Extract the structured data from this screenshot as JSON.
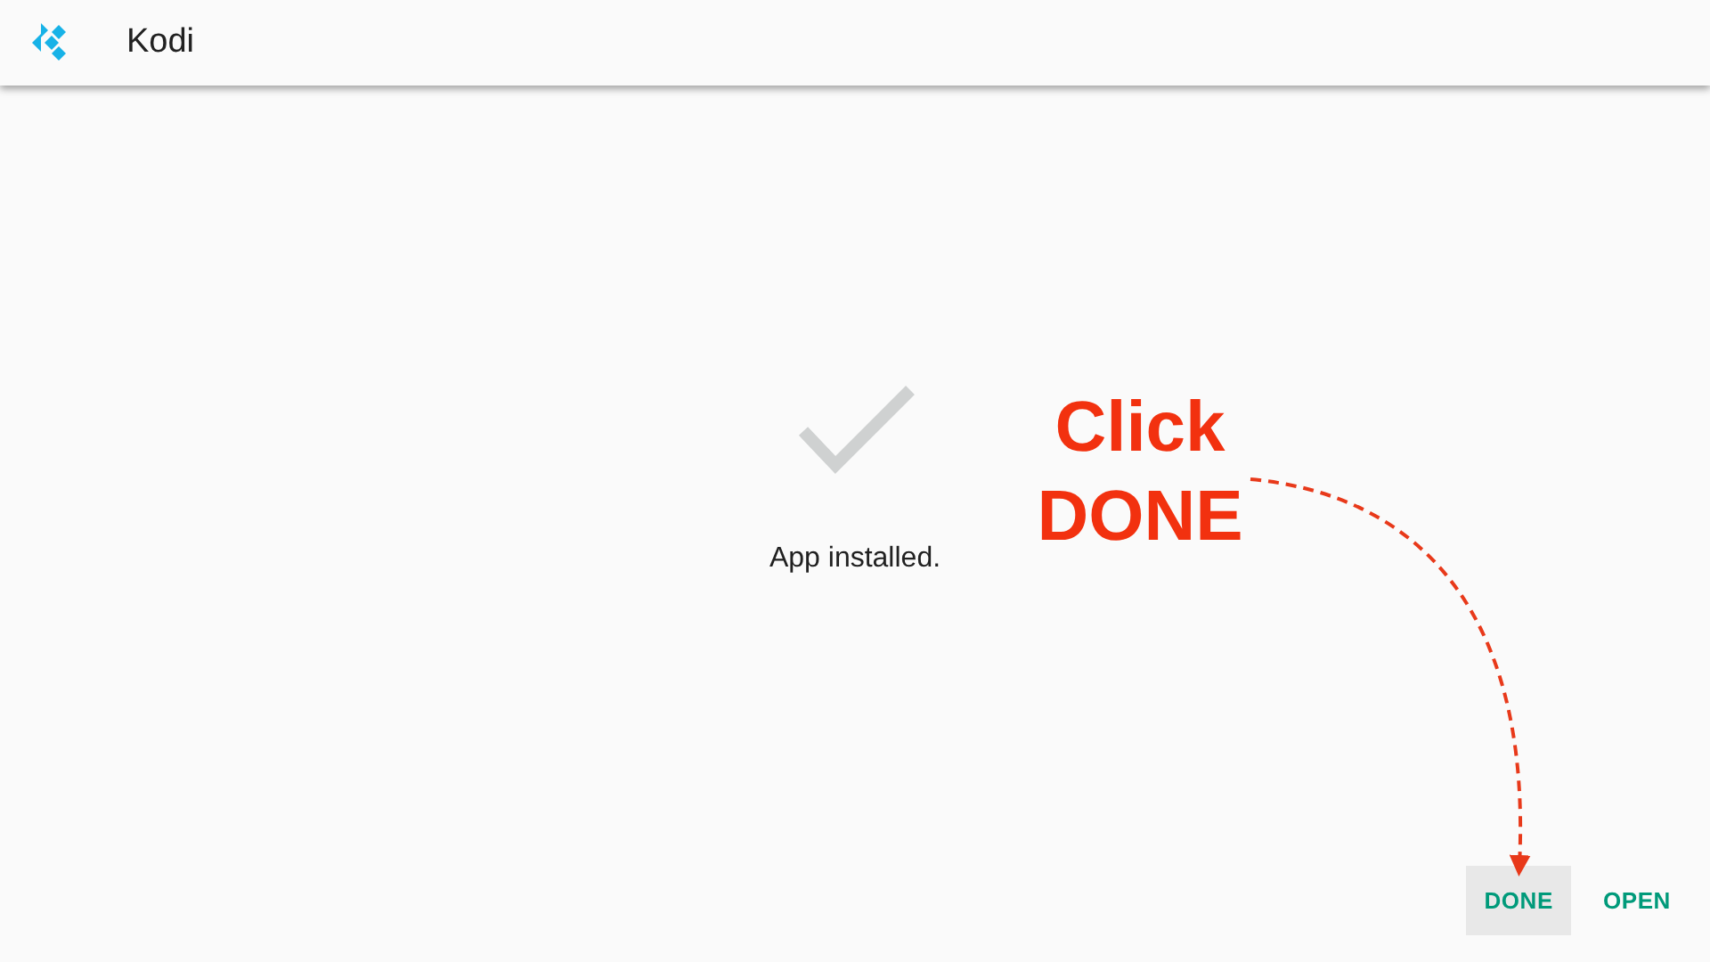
{
  "app_bar": {
    "title": "Kodi"
  },
  "status": {
    "message": "App installed."
  },
  "buttons": [
    {
      "label": "DONE",
      "focused": true
    },
    {
      "label": "OPEN",
      "focused": false
    }
  ],
  "annotation": {
    "lines": [
      "Click",
      "DONE"
    ]
  }
}
